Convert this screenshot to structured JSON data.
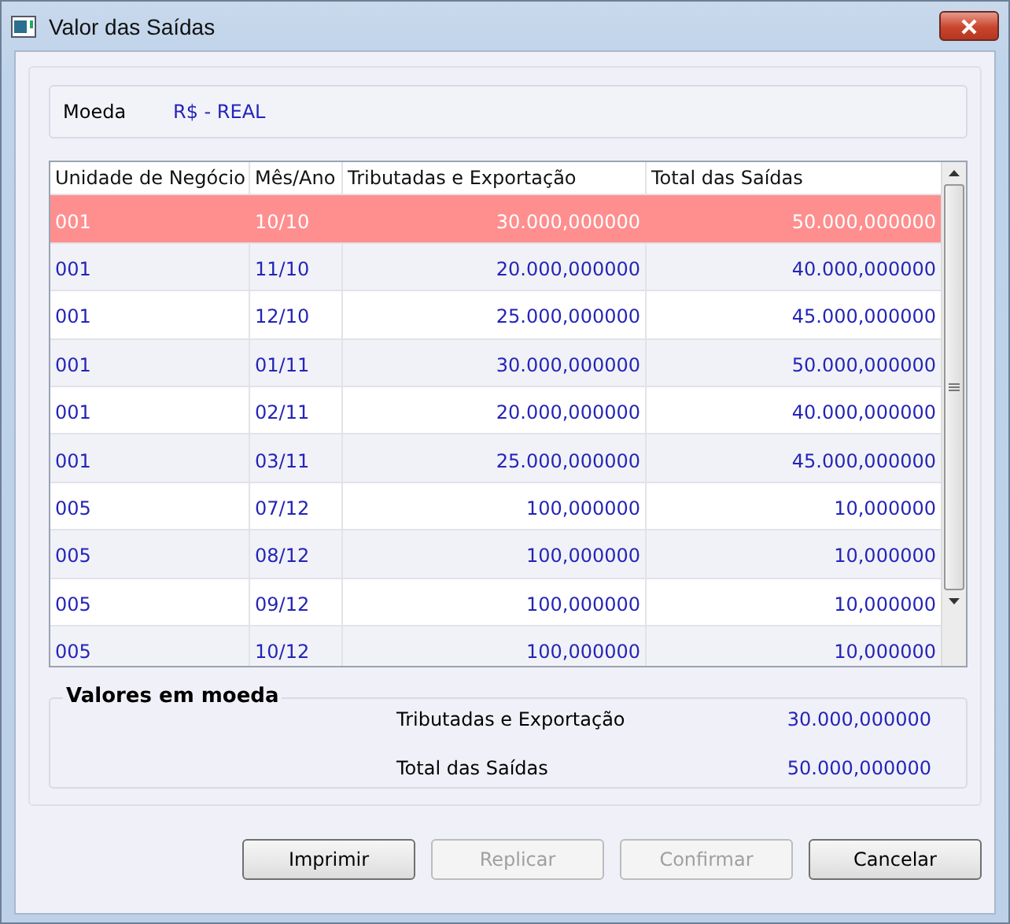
{
  "window": {
    "title": "Valor das Saídas"
  },
  "currency": {
    "label": "Moeda",
    "value": "R$ - REAL"
  },
  "table": {
    "columns": [
      "Unidade de Negócio",
      "Mês/Ano",
      "Tributadas e Exportação",
      "Total das Saídas"
    ],
    "rows": [
      {
        "cells": [
          "001",
          "10/10",
          "30.000,000000",
          "50.000,000000"
        ],
        "selected": true
      },
      {
        "cells": [
          "001",
          "11/10",
          "20.000,000000",
          "40.000,000000"
        ],
        "selected": false
      },
      {
        "cells": [
          "001",
          "12/10",
          "25.000,000000",
          "45.000,000000"
        ],
        "selected": false
      },
      {
        "cells": [
          "001",
          "01/11",
          "30.000,000000",
          "50.000,000000"
        ],
        "selected": false
      },
      {
        "cells": [
          "001",
          "02/11",
          "20.000,000000",
          "40.000,000000"
        ],
        "selected": false
      },
      {
        "cells": [
          "001",
          "03/11",
          "25.000,000000",
          "45.000,000000"
        ],
        "selected": false
      },
      {
        "cells": [
          "005",
          "07/12",
          "100,000000",
          "10,000000"
        ],
        "selected": false
      },
      {
        "cells": [
          "005",
          "08/12",
          "100,000000",
          "10,000000"
        ],
        "selected": false
      },
      {
        "cells": [
          "005",
          "09/12",
          "100,000000",
          "10,000000"
        ],
        "selected": false
      },
      {
        "cells": [
          "005",
          "10/12",
          "100,000000",
          "10,000000"
        ],
        "selected": false
      }
    ]
  },
  "summary": {
    "title": "Valores em moeda",
    "fields": [
      {
        "label": "Tributadas e Exportação",
        "value": "30.000,000000"
      },
      {
        "label": "Total das Saídas",
        "value": "50.000,000000"
      }
    ]
  },
  "buttons": [
    {
      "label": "Imprimir",
      "disabled": false
    },
    {
      "label": "Replicar",
      "disabled": true
    },
    {
      "label": "Confirmar",
      "disabled": true
    },
    {
      "label": "Cancelar",
      "disabled": false
    }
  ]
}
